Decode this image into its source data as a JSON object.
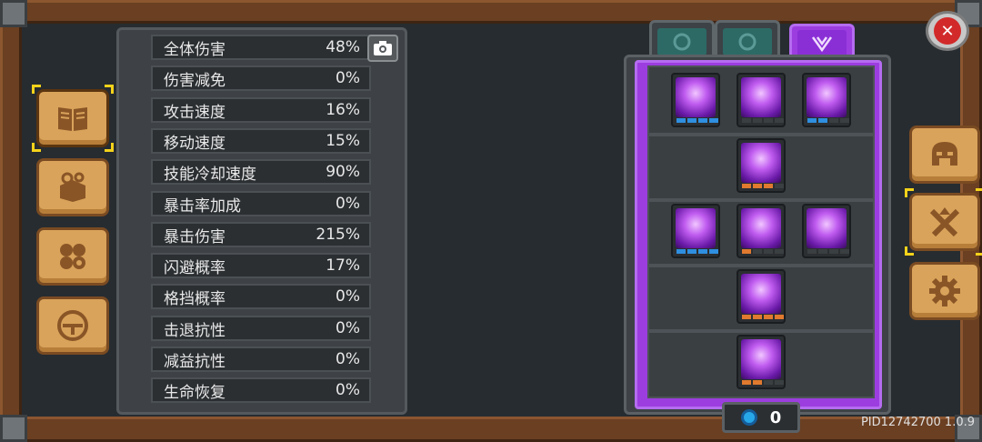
{
  "stats": [
    {
      "label": "全体伤害",
      "value": "48%"
    },
    {
      "label": "伤害减免",
      "value": "0%"
    },
    {
      "label": "攻击速度",
      "value": "16%"
    },
    {
      "label": "移动速度",
      "value": "15%"
    },
    {
      "label": "技能冷却速度",
      "value": "90%"
    },
    {
      "label": "暴击率加成",
      "value": "0%"
    },
    {
      "label": "暴击伤害",
      "value": "215%"
    },
    {
      "label": "闪避概率",
      "value": "17%"
    },
    {
      "label": "格挡概率",
      "value": "0%"
    },
    {
      "label": "击退抗性",
      "value": "0%"
    },
    {
      "label": "减益抗性",
      "value": "0%"
    },
    {
      "label": "生命恢复",
      "value": "0%"
    }
  ],
  "currency": {
    "amount": "0"
  },
  "footer": {
    "pid": "PID12742700 1.0.9"
  },
  "colors": {
    "accent_purple": "#9c3de0",
    "wood": "#d9a35b",
    "pip_blue": "#2f8fe0",
    "pip_orange": "#e07a2f"
  },
  "icons": {
    "left_categories": [
      "book-icon",
      "scroll-map-icon",
      "gears-cluster-icon",
      "helmet-emblem-icon"
    ],
    "right_buttons": [
      "helmet-icon",
      "crossed-swords-upgrade-icon",
      "gear-icon"
    ],
    "tabs": [
      "emblem-icon",
      "emblem-icon",
      "purple-crest-icon"
    ]
  },
  "skills": {
    "row1": [
      {
        "pips": "blue",
        "count": 4
      },
      {
        "pips": "none",
        "count": 4
      },
      {
        "pips": "blue",
        "count": 2
      }
    ],
    "row2": [
      {
        "pips": "orange",
        "count": 3
      }
    ],
    "row3": [
      {
        "pips": "blue",
        "count": 4
      },
      {
        "pips": "orange",
        "count": 1
      },
      {
        "pips": "none",
        "count": 4
      }
    ],
    "row4": [
      {
        "pips": "orange",
        "count": 4
      }
    ],
    "row5": [
      {
        "pips": "orange",
        "count": 2
      }
    ]
  }
}
